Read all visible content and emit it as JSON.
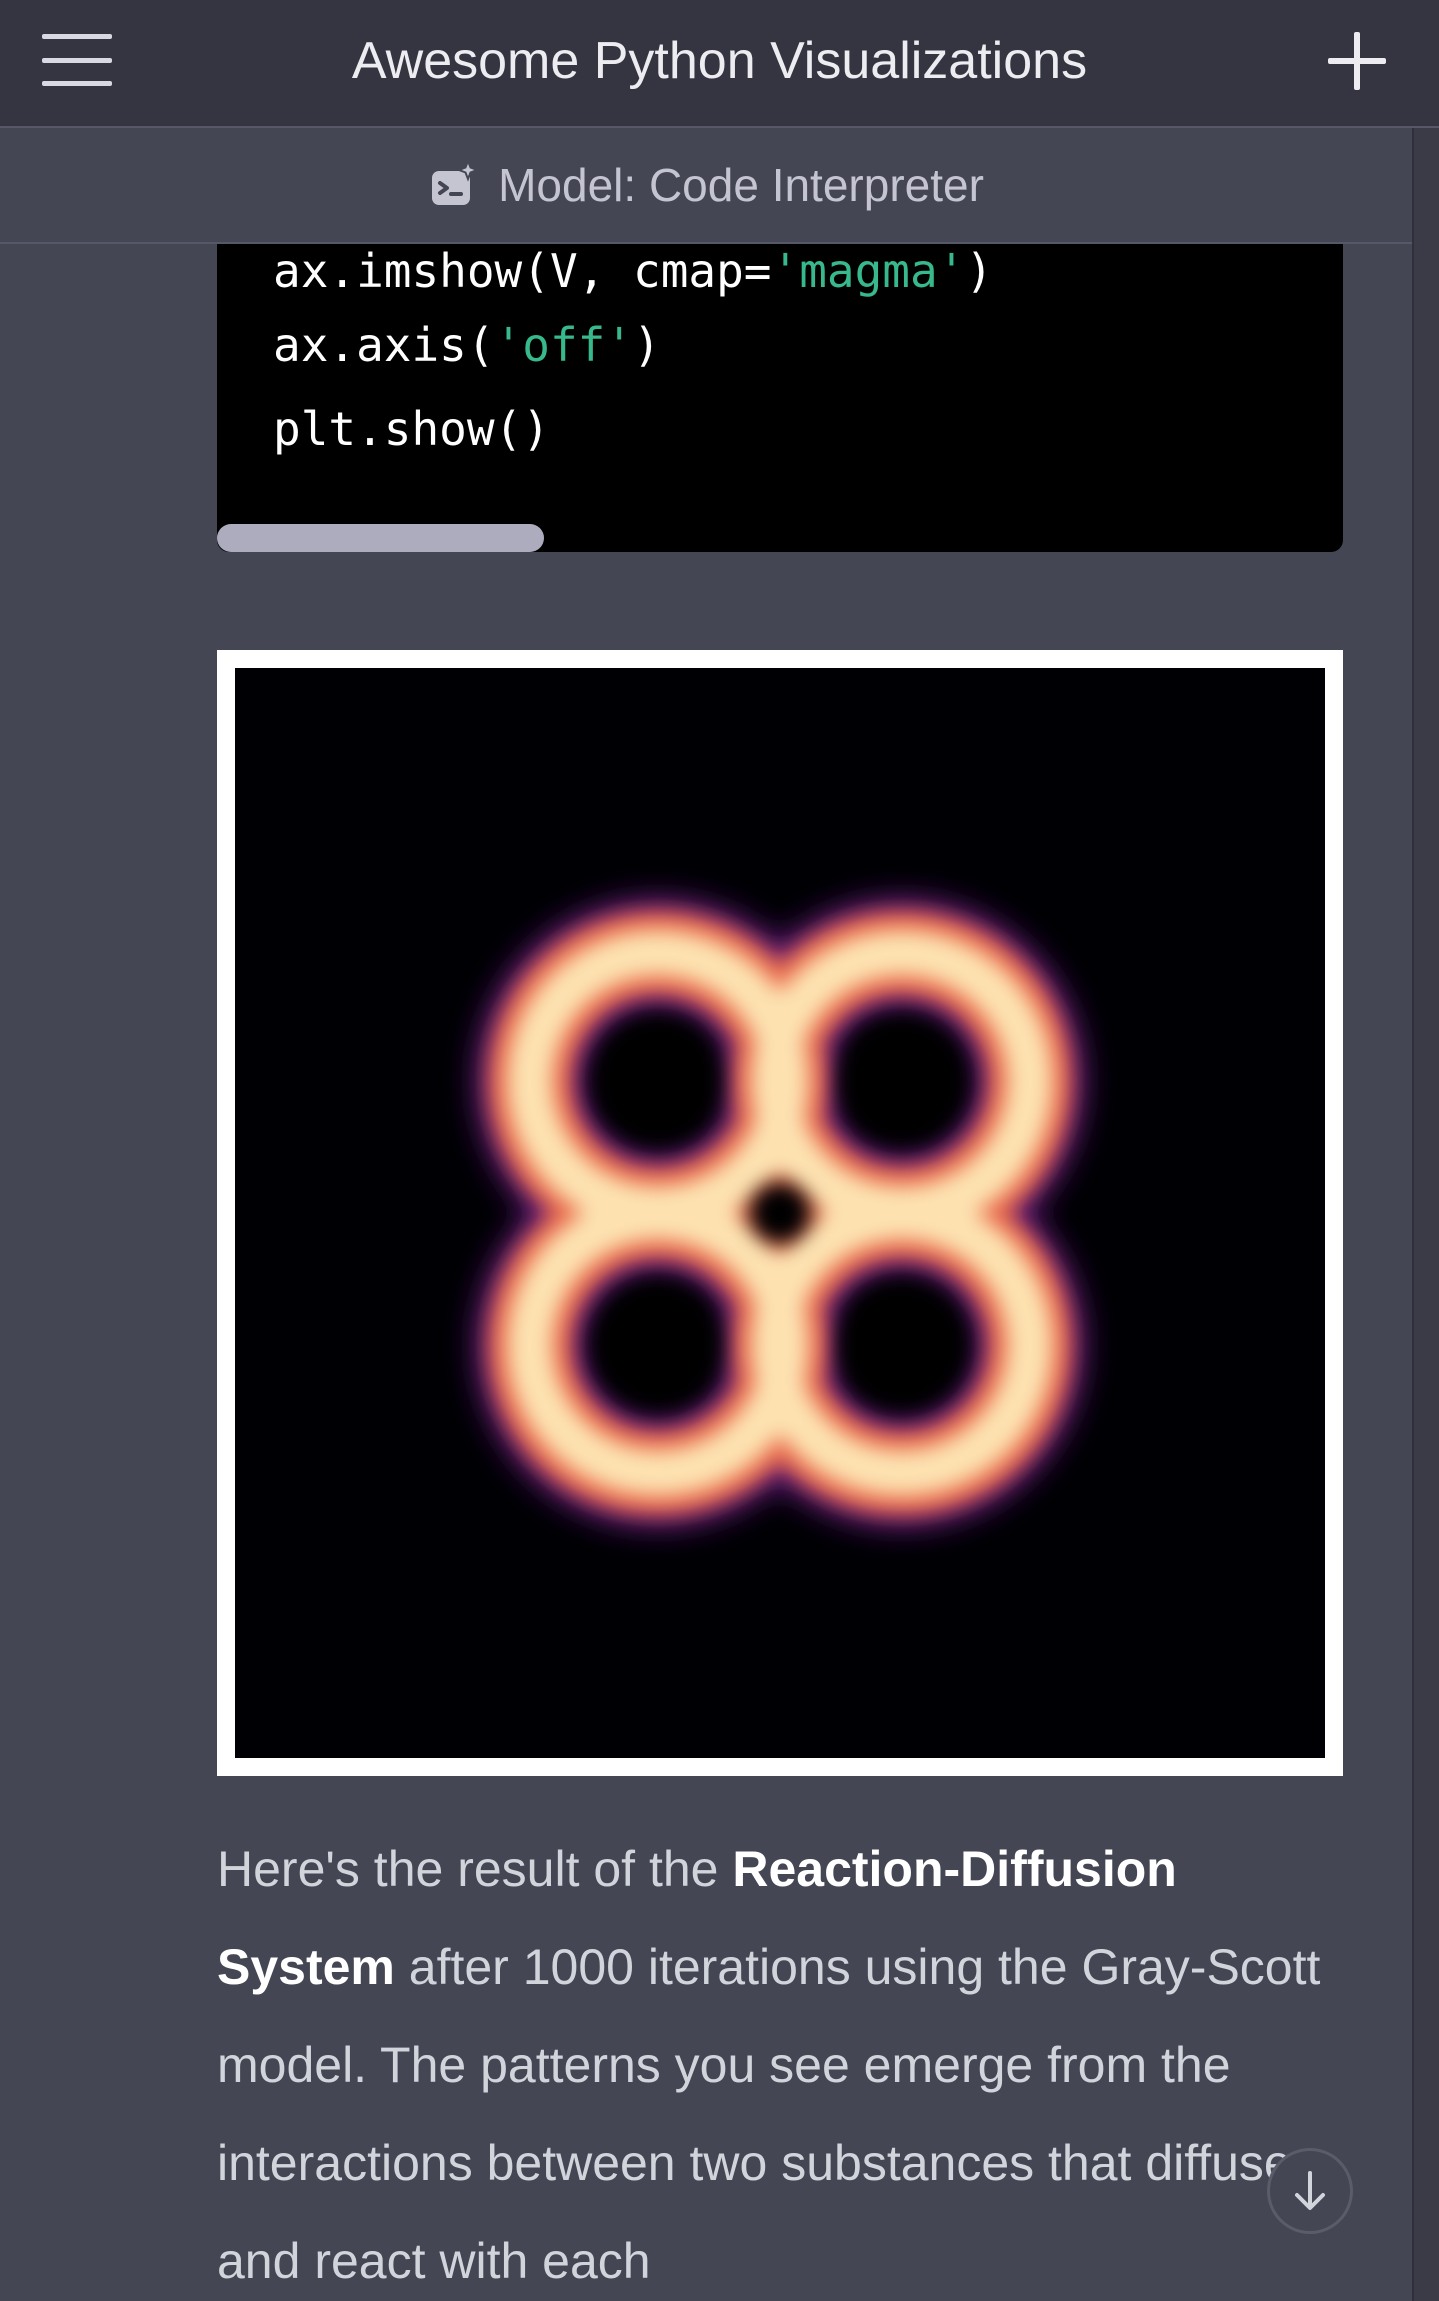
{
  "header": {
    "title": "Awesome Python Visualizations",
    "menu_icon": "hamburger-menu-icon",
    "new_chat_icon": "plus-icon"
  },
  "model_bar": {
    "icon": "code-interpreter-icon",
    "label": "Model: Code Interpreter"
  },
  "code": {
    "lines": [
      {
        "prefix": "ax.imshow(V, cmap=",
        "string": "'magma'",
        "suffix": ")"
      },
      {
        "prefix": "ax.axis(",
        "string": "'off'",
        "suffix": ")"
      },
      {
        "prefix": "plt.show()",
        "string": "",
        "suffix": ""
      }
    ],
    "horizontal_scroll_fraction": 0.29
  },
  "image": {
    "description_icon": "reaction-diffusion-magma-image",
    "colormap": "magma"
  },
  "response": {
    "intro": "Here's the result of the ",
    "bold1": "Reaction-Diffusion System",
    "rest": " after 1000 iterations using the Gray-Scott model. The patterns you see emerge from the interactions between two substances that diffuse and react with each"
  },
  "scroll_button": {
    "icon": "arrow-down-icon"
  },
  "colors": {
    "topbar": "#343541",
    "background": "#444654",
    "code_bg": "#000000",
    "code_string": "#37b98b"
  }
}
